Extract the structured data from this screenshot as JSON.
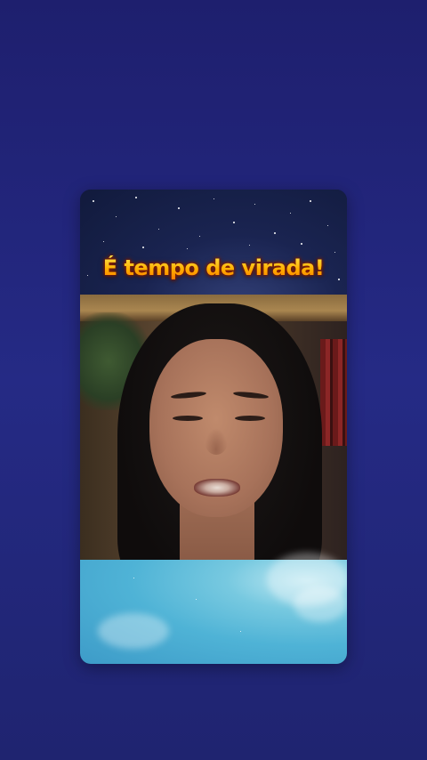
{
  "background_color": "#222779",
  "card": {
    "headline": "É tempo de virada!",
    "headline_colors": [
      "#ffe44d",
      "#ffb000",
      "#ff7a00"
    ]
  },
  "video": {
    "description_icon": "person-speaking"
  }
}
